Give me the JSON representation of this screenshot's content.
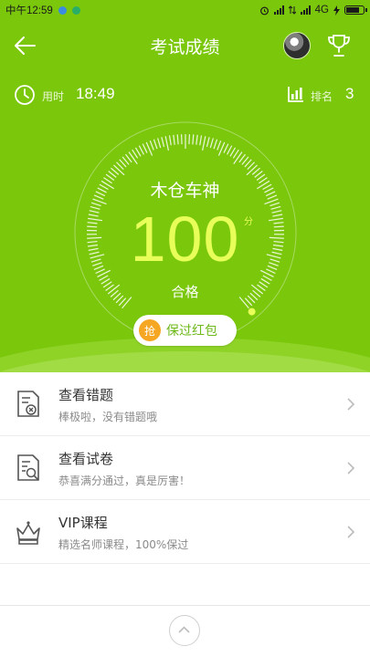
{
  "status_bar": {
    "time": "中午12:59",
    "network": "4G",
    "battery_fraction": 0.8
  },
  "nav": {
    "title": "考试成绩",
    "back_icon": "arrow-left-icon",
    "avatar": "user-avatar",
    "trophy_icon": "trophy-icon"
  },
  "info": {
    "time_label": "用时",
    "time_value": "18:49",
    "rank_label": "排名",
    "rank_value": "3"
  },
  "score": {
    "name": "木仓车神",
    "value": "100",
    "unit": "分",
    "status": "合格",
    "gauge_fraction": 1.0
  },
  "redpack": {
    "badge": "抢",
    "label": "保过红包"
  },
  "menu": [
    {
      "title": "查看错题",
      "subtitle": "棒极啦，没有错题哦",
      "icon": "wrong-questions-icon"
    },
    {
      "title": "查看试卷",
      "subtitle": "恭喜满分通过，真是厉害！",
      "icon": "view-paper-icon"
    },
    {
      "title": "VIP课程",
      "subtitle": "精选名师课程，100%保过",
      "icon": "crown-icon"
    }
  ],
  "colors": {
    "hero_green": "#7ac70c",
    "score_yellow": "#e8ff59",
    "badge_orange": "#f5a623"
  }
}
